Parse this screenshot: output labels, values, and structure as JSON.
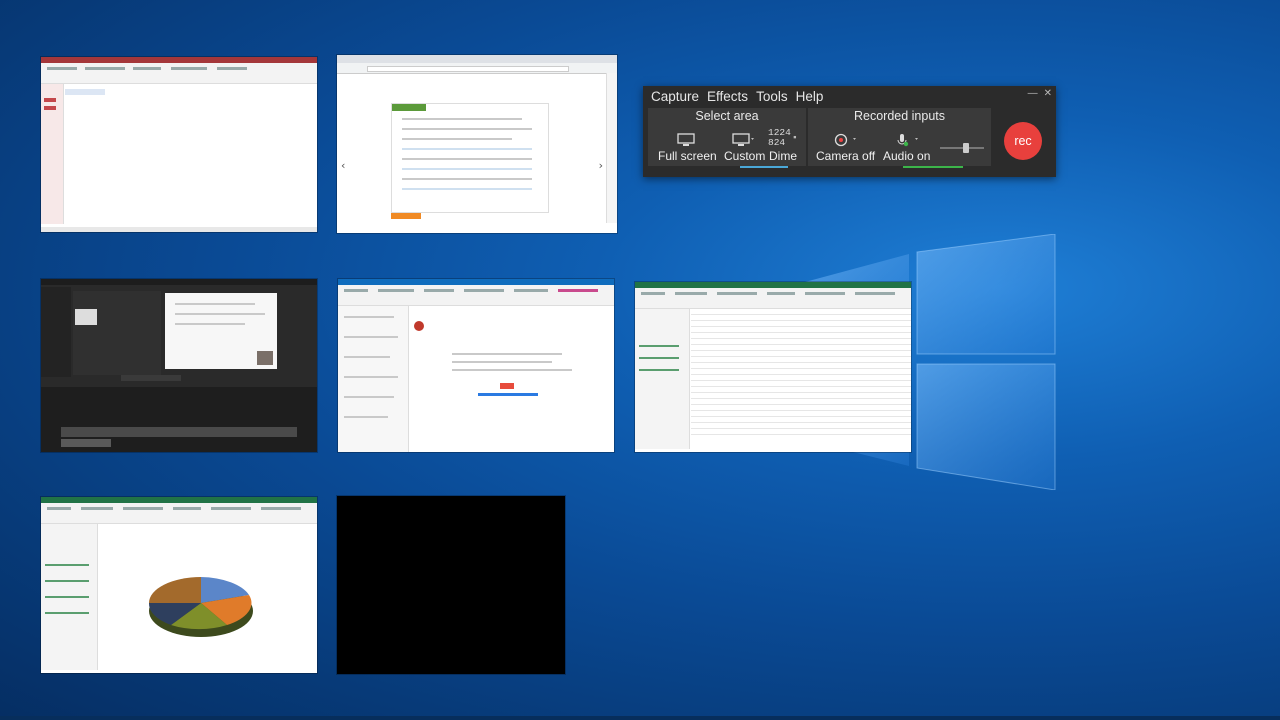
{
  "recorder": {
    "menu": [
      "Capture",
      "Effects",
      "Tools",
      "Help"
    ],
    "select_area_title": "Select area",
    "recorded_inputs_title": "Recorded inputs",
    "full_screen_label": "Full screen",
    "custom_label": "Custom",
    "dimensions_label": "Dime",
    "width_value": "1224",
    "height_value": "824",
    "camera_label": "Camera off",
    "audio_label": "Audio on",
    "rec_label": "rec",
    "audio_level": 0.6
  },
  "task_view": {
    "windows": [
      {
        "app": "Access"
      },
      {
        "app": "Browser"
      },
      {
        "app": "Camtasia"
      },
      {
        "app": "Outlook"
      },
      {
        "app": "Excel"
      },
      {
        "app": "Excel Chart"
      },
      {
        "app": "Blank"
      }
    ]
  },
  "colors": {
    "access_red": "#a4373a",
    "excel_green": "#217346",
    "outlook_blue": "#0f6cbd",
    "camtasia_dark": "#2a2a2a",
    "rec_red": "#e8403d",
    "desktop_blue": "#0a4a95"
  }
}
